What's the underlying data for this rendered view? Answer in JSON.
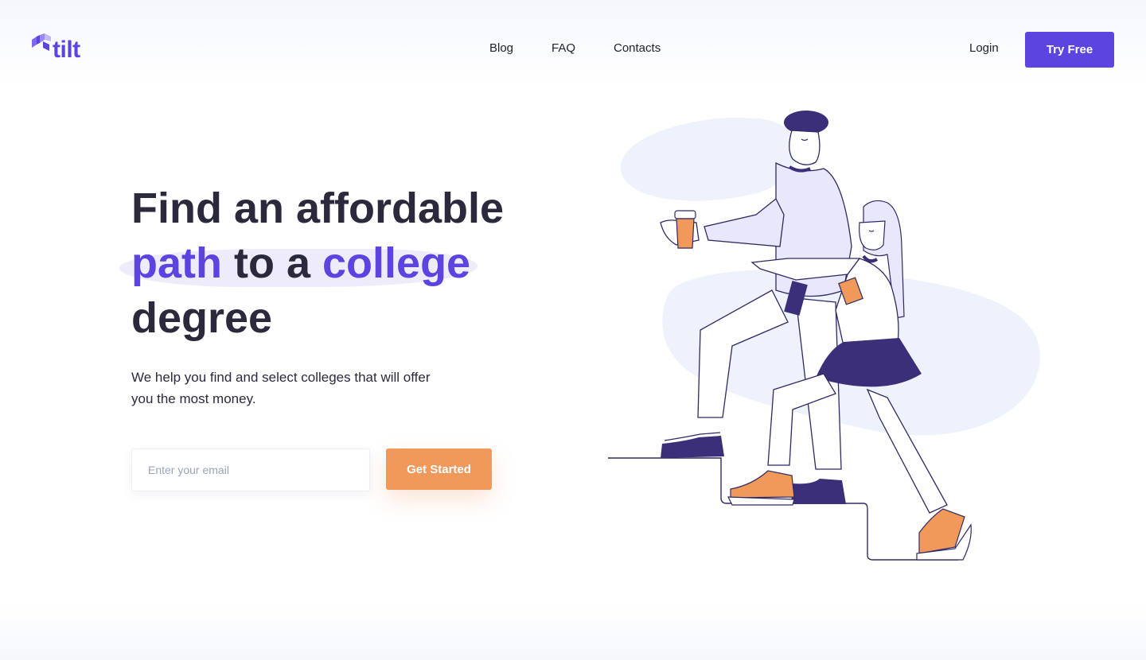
{
  "header": {
    "logo_text": "tilt",
    "nav": [
      {
        "label": "Blog"
      },
      {
        "label": "FAQ"
      },
      {
        "label": "Contacts"
      }
    ],
    "login_label": "Login",
    "cta_label": "Try Free"
  },
  "hero": {
    "headline": {
      "line1": "Find an affordable",
      "line2_accent1": "path",
      "line2_mid": " to a ",
      "line2_accent2": "college",
      "line3": "degree"
    },
    "subtext": "We help you find and select colleges that will offer you the most money.",
    "email_placeholder": "Enter your email",
    "email_value": "",
    "submit_label": "Get Started"
  },
  "colors": {
    "brand": "#5b44e0",
    "accent": "#f0995a",
    "text": "#2b2a3d"
  }
}
